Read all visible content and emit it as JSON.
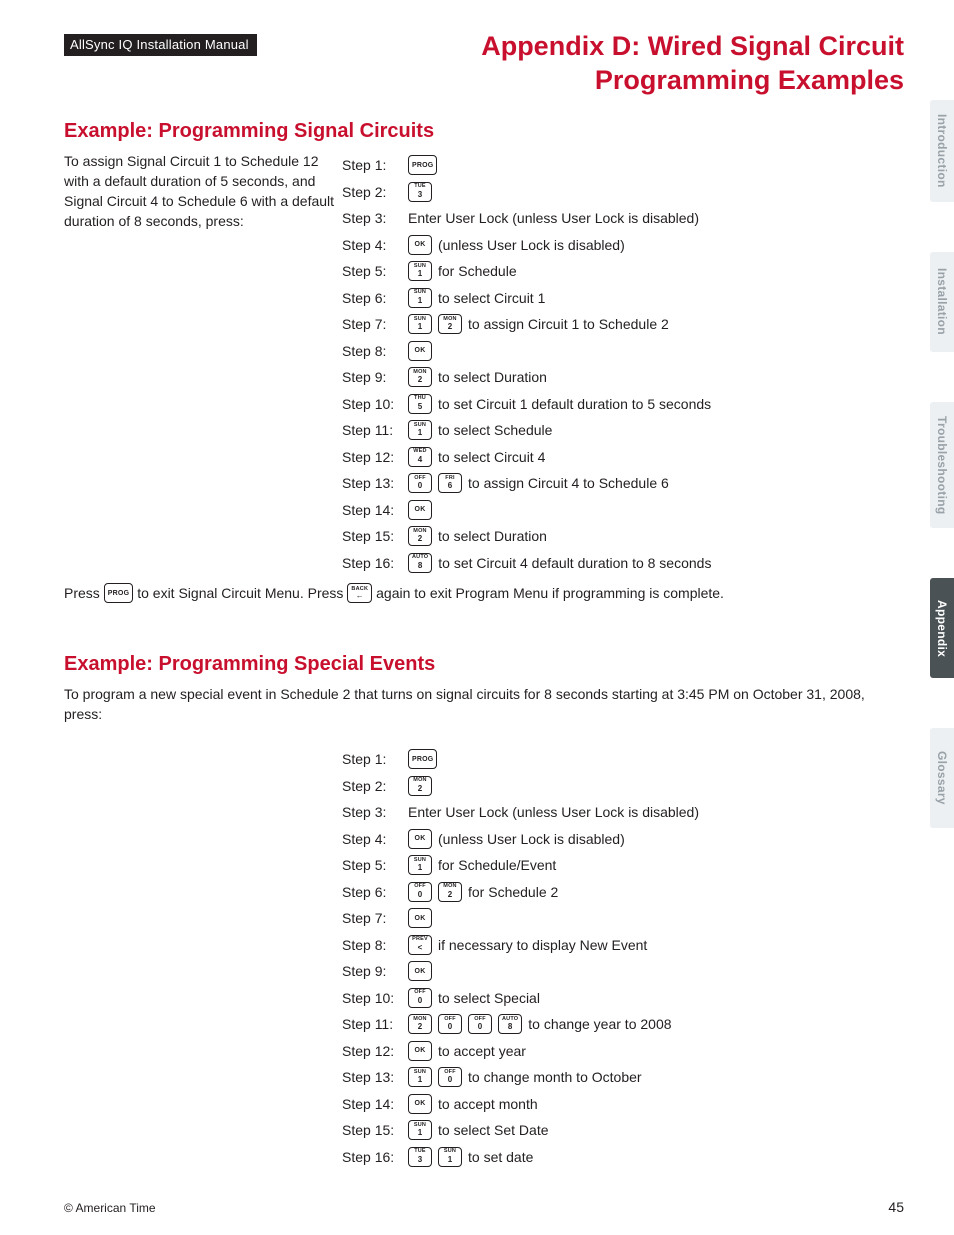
{
  "header": {
    "manual_title": "AllSync IQ Installation Manual",
    "page_title_line1": "Appendix D: Wired Signal Circuit",
    "page_title_line2": "Programming Examples"
  },
  "tabs": [
    {
      "label": "Introduction",
      "active": false
    },
    {
      "label": "Installation",
      "active": false
    },
    {
      "label": "Troubleshooting",
      "active": false
    },
    {
      "label": "Appendix",
      "active": true
    },
    {
      "label": "Glossary",
      "active": false
    }
  ],
  "ex1": {
    "title": "Example: Programming Signal Circuits",
    "intro": "To assign Signal Circuit 1 to Schedule 12 with a default duration of 5 seconds, and Signal Circuit 4 to Schedule 6 with a default duration of 8 seconds, press:",
    "steps": [
      {
        "label": "Step 1:",
        "keys": [
          {
            "t": "PROG"
          }
        ],
        "text": ""
      },
      {
        "label": "Step 2:",
        "keys": [
          {
            "t": "TUE",
            "b": "3"
          }
        ],
        "text": ""
      },
      {
        "label": "Step 3:",
        "keys": [],
        "text": "Enter User Lock (unless User Lock is disabled)"
      },
      {
        "label": "Step 4:",
        "keys": [
          {
            "t": "OK"
          }
        ],
        "text": "(unless User Lock is disabled)"
      },
      {
        "label": "Step 5:",
        "keys": [
          {
            "t": "SUN",
            "b": "1"
          }
        ],
        "text": "for Schedule"
      },
      {
        "label": "Step 6:",
        "keys": [
          {
            "t": "SUN",
            "b": "1"
          }
        ],
        "text": "to select Circuit 1"
      },
      {
        "label": "Step 7:",
        "keys": [
          {
            "t": "SUN",
            "b": "1"
          },
          {
            "t": "MON",
            "b": "2"
          }
        ],
        "text": "to assign Circuit 1 to Schedule 2"
      },
      {
        "label": "Step 8:",
        "keys": [
          {
            "t": "OK"
          }
        ],
        "text": ""
      },
      {
        "label": "Step 9:",
        "keys": [
          {
            "t": "MON",
            "b": "2"
          }
        ],
        "text": "to select Duration"
      },
      {
        "label": "Step 10:",
        "keys": [
          {
            "t": "THU",
            "b": "5"
          }
        ],
        "text": "to set Circuit 1 default duration to 5 seconds"
      },
      {
        "label": "Step 11:",
        "keys": [
          {
            "t": "SUN",
            "b": "1"
          }
        ],
        "text": "to select Schedule"
      },
      {
        "label": "Step 12:",
        "keys": [
          {
            "t": "WED",
            "b": "4"
          }
        ],
        "text": "to select Circuit 4"
      },
      {
        "label": "Step 13:",
        "keys": [
          {
            "t": "OFF",
            "b": "0"
          },
          {
            "t": "FRI",
            "b": "6"
          }
        ],
        "text": "to assign Circuit 4 to Schedule 6"
      },
      {
        "label": "Step 14:",
        "keys": [
          {
            "t": "OK"
          }
        ],
        "text": ""
      },
      {
        "label": "Step 15:",
        "keys": [
          {
            "t": "MON",
            "b": "2"
          }
        ],
        "text": "to select Duration"
      },
      {
        "label": "Step 16:",
        "keys": [
          {
            "t": "AUTO",
            "b": "8"
          }
        ],
        "text": "to set Circuit 4 default duration to 8 seconds"
      }
    ],
    "footnote": {
      "p1": "Press",
      "k1": {
        "t": "PROG"
      },
      "p2": "to exit Signal Circuit Menu. Press",
      "k2": {
        "t": "BACK",
        "b": "←"
      },
      "p3": "again to exit Program Menu if programming is complete."
    }
  },
  "ex2": {
    "title": "Example: Programming Special Events",
    "intro": "To program a new special event in Schedule 2 that turns on signal circuits for 8 seconds starting at 3:45 PM on October 31, 2008, press:",
    "steps": [
      {
        "label": "Step 1:",
        "keys": [
          {
            "t": "PROG"
          }
        ],
        "text": ""
      },
      {
        "label": "Step 2:",
        "keys": [
          {
            "t": "MON",
            "b": "2"
          }
        ],
        "text": ""
      },
      {
        "label": "Step 3:",
        "keys": [],
        "text": "Enter User Lock (unless User Lock is disabled)"
      },
      {
        "label": "Step 4:",
        "keys": [
          {
            "t": "OK"
          }
        ],
        "text": "(unless User Lock is disabled)"
      },
      {
        "label": "Step 5:",
        "keys": [
          {
            "t": "SUN",
            "b": "1"
          }
        ],
        "text": "for Schedule/Event"
      },
      {
        "label": "Step 6:",
        "keys": [
          {
            "t": "OFF",
            "b": "0"
          },
          {
            "t": "MON",
            "b": "2"
          }
        ],
        "text": "for Schedule 2"
      },
      {
        "label": "Step 7:",
        "keys": [
          {
            "t": "OK"
          }
        ],
        "text": ""
      },
      {
        "label": "Step 8:",
        "keys": [
          {
            "t": "PREV",
            "b": "<"
          }
        ],
        "text": "if necessary to display New Event"
      },
      {
        "label": "Step 9:",
        "keys": [
          {
            "t": "OK"
          }
        ],
        "text": ""
      },
      {
        "label": "Step 10:",
        "keys": [
          {
            "t": "OFF",
            "b": "0"
          }
        ],
        "text": "to select Special"
      },
      {
        "label": "Step 11:",
        "keys": [
          {
            "t": "MON",
            "b": "2"
          },
          {
            "t": "OFF",
            "b": "0"
          },
          {
            "t": "OFF",
            "b": "0"
          },
          {
            "t": "AUTO",
            "b": "8"
          }
        ],
        "text": "to change year to 2008"
      },
      {
        "label": "Step 12:",
        "keys": [
          {
            "t": "OK"
          }
        ],
        "text": "to accept year"
      },
      {
        "label": "Step 13:",
        "keys": [
          {
            "t": "SUN",
            "b": "1"
          },
          {
            "t": "OFF",
            "b": "0"
          }
        ],
        "text": "to change month to October"
      },
      {
        "label": "Step 14:",
        "keys": [
          {
            "t": "OK"
          }
        ],
        "text": "to accept month"
      },
      {
        "label": "Step 15:",
        "keys": [
          {
            "t": "SUN",
            "b": "1"
          }
        ],
        "text": "to select Set Date"
      },
      {
        "label": "Step 16:",
        "keys": [
          {
            "t": "TUE",
            "b": "3"
          },
          {
            "t": "SUN",
            "b": "1"
          }
        ],
        "text": "to set date"
      }
    ]
  },
  "footer": {
    "copyright": "© American Time",
    "page": "45"
  }
}
